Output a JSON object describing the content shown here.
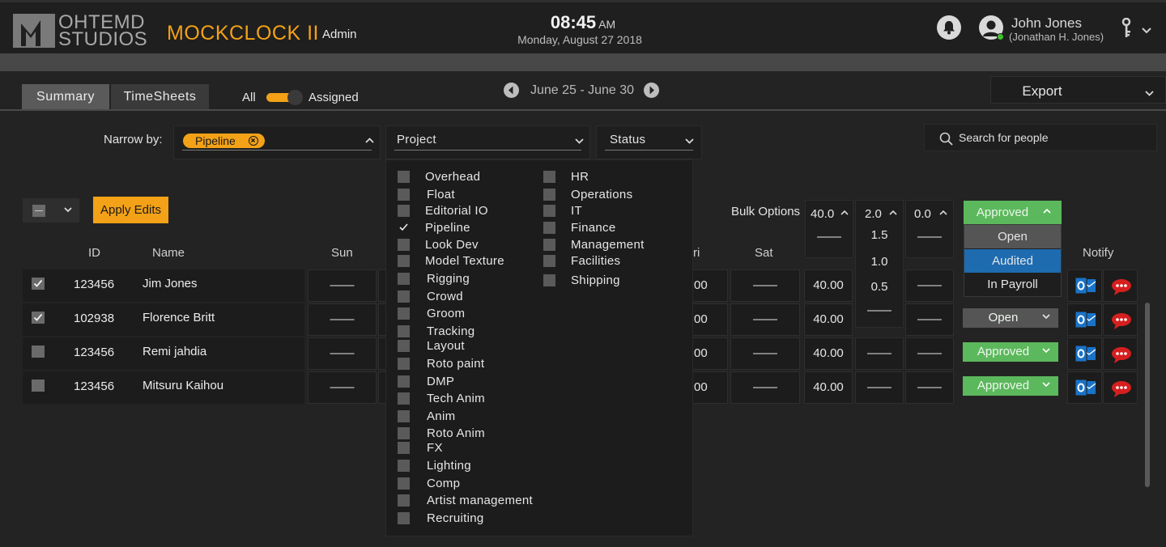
{
  "header": {
    "logo_line1": "OHTEMD",
    "logo_line2": "STUDIOS",
    "app_title": "MOCKCLOCK II",
    "role": "Admin",
    "time": "08:45",
    "ampm": "AM",
    "date": "Monday, August 27 2018",
    "user_name": "John Jones",
    "user_full": "(Jonathan H. Jones)"
  },
  "toolbar": {
    "tabs": [
      {
        "label": "Summary"
      },
      {
        "label": "TimeSheets"
      }
    ],
    "toggle_left": "All",
    "toggle_right": "Assigned",
    "date_range": "June 25 - June 30",
    "export_label": "Export"
  },
  "filters": {
    "narrow_label": "Narrow by:",
    "chip": "Pipeline",
    "project_label": "Project",
    "status_label": "Status",
    "search_placeholder": "Search for people"
  },
  "bulk": {
    "apply_label": "Apply Edits",
    "label": "Bulk Options",
    "col1_value": "40.0",
    "col1_options": [
      "——"
    ],
    "col2_value": "2.0",
    "col2_options": [
      "1.5",
      "1.0",
      "0.5",
      "——"
    ],
    "col3_value": "0.0",
    "col3_options": [
      "——"
    ],
    "status_value": "Approved",
    "status_options": [
      "Open",
      "Audited",
      "In Payroll"
    ]
  },
  "table": {
    "headers": {
      "id": "ID",
      "name": "Name",
      "sun": "Sun",
      "fri": "ri",
      "sat": "Sat",
      "notify": "Notify"
    },
    "rows": [
      {
        "checked": true,
        "id": "123456",
        "name": "Jim Jones",
        "sun": "——",
        "fri": "00",
        "sat": "——",
        "total": "40.00",
        "ot": "",
        "dt": "——",
        "status": ""
      },
      {
        "checked": true,
        "id": "102938",
        "name": "Florence Britt",
        "sun": "——",
        "fri": "00",
        "sat": "——",
        "total": "40.00",
        "ot": "",
        "dt": "——",
        "status": "Open"
      },
      {
        "checked": false,
        "id": "123456",
        "name": "Remi jahdia",
        "sun": "——",
        "fri": "00",
        "sat": "——",
        "total": "40.00",
        "ot": "——",
        "dt": "——",
        "status": "Approved"
      },
      {
        "checked": false,
        "id": "123456",
        "name": "Mitsuru Kaihou",
        "sun": "——",
        "fri": "00",
        "sat": "——",
        "total": "40.00",
        "ot": "——",
        "dt": "——",
        "status": "Approved"
      }
    ]
  },
  "project_menu": {
    "col1": [
      {
        "label": "Overhead",
        "checked": false
      },
      {
        "label": "Float",
        "checked": false
      },
      {
        "label": "Editorial IO",
        "checked": false
      },
      {
        "label": "Pipeline",
        "checked": true
      },
      {
        "label": "Look Dev",
        "checked": false
      },
      {
        "label": "Model Texture",
        "checked": false
      },
      {
        "label": "Rigging",
        "checked": false
      },
      {
        "label": "Crowd",
        "checked": false
      },
      {
        "label": "Groom",
        "checked": false
      },
      {
        "label": "Tracking",
        "checked": false
      },
      {
        "label": "Layout",
        "checked": false
      },
      {
        "label": "Roto paint",
        "checked": false
      },
      {
        "label": "DMP",
        "checked": false
      },
      {
        "label": "Tech Anim",
        "checked": false
      },
      {
        "label": "Anim",
        "checked": false
      },
      {
        "label": "Roto Anim",
        "checked": false
      },
      {
        "label": "FX",
        "checked": false
      },
      {
        "label": "Lighting",
        "checked": false
      },
      {
        "label": "Comp",
        "checked": false
      },
      {
        "label": "Artist management",
        "checked": false
      },
      {
        "label": "Recruiting",
        "checked": false
      }
    ],
    "col2": [
      {
        "label": "HR",
        "checked": false
      },
      {
        "label": "Operations",
        "checked": false
      },
      {
        "label": "IT",
        "checked": false
      },
      {
        "label": "Finance",
        "checked": false
      },
      {
        "label": "Management",
        "checked": false
      },
      {
        "label": "Facilities",
        "checked": false
      },
      {
        "label": "Shipping",
        "checked": false
      }
    ]
  },
  "colors": {
    "accent": "#f3a117",
    "approved": "#5cb85c",
    "open": "#555555",
    "audited": "#1e6bb0",
    "outlook": "#1a73c8",
    "chat": "#d61f1f",
    "background": "#232323"
  },
  "icons": [
    "bell-icon",
    "user-icon",
    "key-icon",
    "search-icon",
    "checkmark-icon",
    "outlook-icon",
    "chat-icon",
    "chevron-left-icon",
    "chevron-right-icon",
    "chevron-down-icon",
    "chevron-up-icon"
  ]
}
